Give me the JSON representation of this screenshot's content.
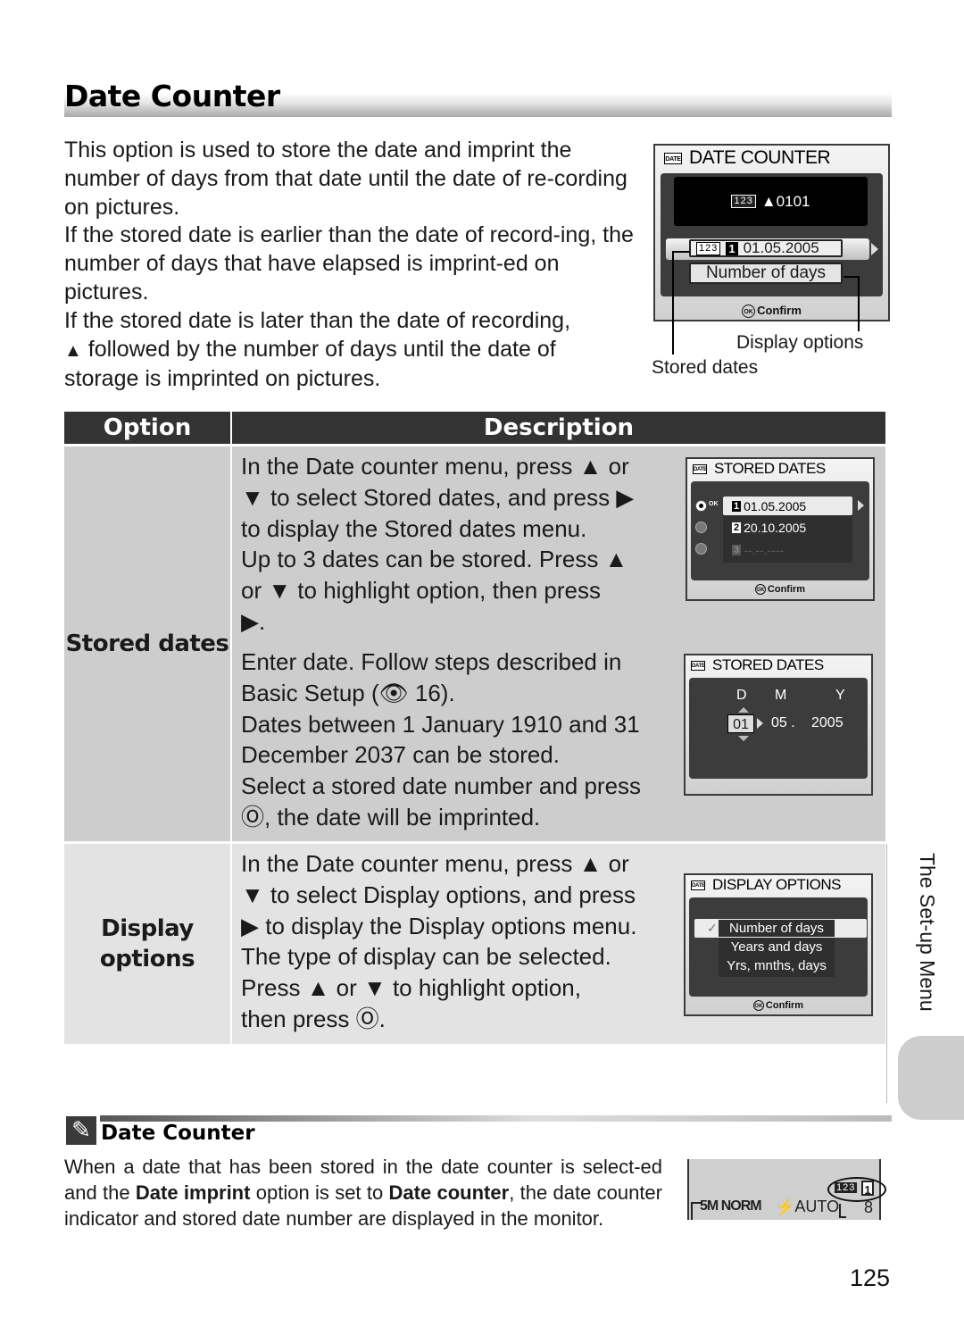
{
  "title": "Date Counter",
  "intro": {
    "p1": "This option is used to store the date and imprint the number of days from that date until the date of re-cording on pictures.",
    "p2": "If the stored date is earlier than the date of record-ing, the number of days that have elapsed is imprint-ed on pictures.",
    "p3_lead": "If the stored date is later than the date of recording,",
    "p3_triangle": "▲",
    "p3_rest": " followed by the number of days until the date of storage is imprinted on pictures."
  },
  "date_counter_screen": {
    "icon_label": "DATE",
    "title": "DATE COUNTER",
    "counter_icon": "123",
    "counter_value": "▲0101",
    "stored_num": "1",
    "stored_date": "01.05.2005",
    "display_option": "Number of days",
    "confirm_label": "Confirm",
    "ok_label": "OK",
    "callout_display": "Display options",
    "callout_stored": "Stored dates"
  },
  "table": {
    "header": {
      "option": "Option",
      "description": "Description"
    },
    "rows": [
      {
        "option": "Stored dates",
        "desc_a": [
          "In the Date counter menu, press ▲ or",
          "▼ to select Stored dates, and press ▶",
          "to display the Stored dates menu.",
          "Up to 3 dates can be stored. Press ▲",
          "or ▼ to highlight option, then press",
          "▶."
        ],
        "desc_b": [
          "Enter date. Follow steps described in",
          "Basic Setup (👁 16).",
          "Dates between 1 January 1910 and 31",
          "December 2037 can be stored.",
          "Select a stored date number and press",
          "Ⓞ, the date will be imprinted."
        ]
      },
      {
        "option_line1": "Display",
        "option_line2": "options",
        "desc": [
          "In the Date counter menu, press ▲ or",
          "▼ to select Display options, and press",
          "▶ to display the Display options menu.",
          "The type of display can be selected.",
          "Press ▲ or ▼ to highlight option,",
          "then press Ⓞ."
        ]
      }
    ]
  },
  "stored_dates_screen": {
    "icon_label": "DATE",
    "title": "STORED DATES",
    "ok_tag": "OK",
    "entries": [
      {
        "num": "1",
        "date": "01.05.2005",
        "selected": true
      },
      {
        "num": "2",
        "date": "20.10.2005",
        "selected": false
      },
      {
        "num": "3",
        "date": "--.--.----",
        "selected": false
      }
    ],
    "confirm_label": "Confirm",
    "ok_label": "OK"
  },
  "stored_dates_edit_screen": {
    "icon_label": "DATE",
    "title": "STORED DATES",
    "col_d": "D",
    "col_m": "M",
    "col_y": "Y",
    "day": "01",
    "month": "05 .",
    "year": "2005"
  },
  "display_options_screen": {
    "icon_label": "DATE",
    "title": "DISPLAY OPTIONS",
    "options": [
      "Number of days",
      "Years and days",
      "Yrs, mnths, days"
    ],
    "selected_index": 0,
    "checkmark": "✓",
    "confirm_label": "Confirm",
    "ok_label": "OK"
  },
  "note": {
    "icon": "✎",
    "title": "Date Counter",
    "body_1": "When a date that has been stored in the date counter is select-ed and the ",
    "bold_1": "Date imprint",
    "body_2": " option is set to ",
    "bold_2": "Date counter",
    "body_3": ", the date counter indicator and stored date number are displayed in the monitor."
  },
  "monitor": {
    "image_size": "5M",
    "quality": "NORM",
    "flash_icon": "⚡",
    "flash_mode": "AUTO",
    "counter_icon": "123",
    "stored_num": "1",
    "exposures": "8"
  },
  "side_tab": {
    "label": "The Set-up Menu"
  },
  "page_number": "125"
}
